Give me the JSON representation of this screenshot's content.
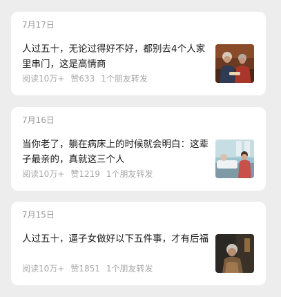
{
  "articles": [
    {
      "date": "7月17日",
      "title": "人过五十，无论过得好不好，都别去4个人家里串门，这是高情商",
      "reads": "阅读10万+",
      "likes": "赞633",
      "shares": "1个朋友转发",
      "thumbnail": "elderly-couple-portrait"
    },
    {
      "date": "7月16日",
      "title": "当你老了，躺在病床上的时候就会明白：这辈子最亲的，真就这三个人",
      "reads": "阅读10万+",
      "likes": "赞1219",
      "shares": "1个朋友转发",
      "thumbnail": "hospital-bedside-scene"
    },
    {
      "date": "7月15日",
      "title": "人过五十，逼子女做好以下五件事，才有后福",
      "reads": "阅读10万+",
      "likes": "赞1851",
      "shares": "1个朋友转发",
      "thumbnail": "elderly-woman-dark-portrait"
    }
  ]
}
